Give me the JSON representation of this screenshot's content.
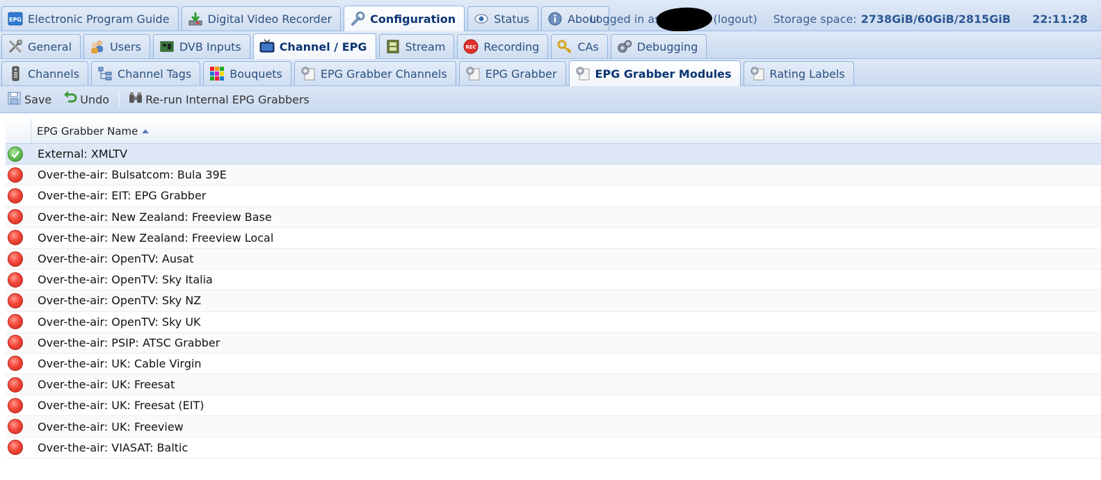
{
  "main_tabs": [
    {
      "label": "Electronic Program Guide",
      "icon": "epg-icon"
    },
    {
      "label": "Digital Video Recorder",
      "icon": "download-icon"
    },
    {
      "label": "Configuration",
      "icon": "wrench-icon",
      "active": true
    },
    {
      "label": "Status",
      "icon": "eye-icon"
    },
    {
      "label": "About",
      "icon": "info-icon"
    }
  ],
  "status": {
    "logged_in_prefix": "Logged in as",
    "logout": "(logout)",
    "storage_label": "Storage space:",
    "storage_value": "2738GiB/60GiB/2815GiB",
    "time": "22:11:28"
  },
  "config_tabs": [
    {
      "label": "General",
      "icon": "tools-icon"
    },
    {
      "label": "Users",
      "icon": "users-icon"
    },
    {
      "label": "DVB Inputs",
      "icon": "card-icon"
    },
    {
      "label": "Channel / EPG",
      "icon": "tv-icon",
      "active": true
    },
    {
      "label": "Stream",
      "icon": "film-icon"
    },
    {
      "label": "Recording",
      "icon": "rec-icon"
    },
    {
      "label": "CAs",
      "icon": "key-icon"
    },
    {
      "label": "Debugging",
      "icon": "gears-icon"
    }
  ],
  "epg_tabs": [
    {
      "label": "Channels",
      "icon": "remote-icon"
    },
    {
      "label": "Channel Tags",
      "icon": "tree-icon"
    },
    {
      "label": "Bouquets",
      "icon": "grid-icon"
    },
    {
      "label": "EPG Grabber Channels",
      "icon": "gear-doc-icon"
    },
    {
      "label": "EPG Grabber",
      "icon": "gear-doc-icon"
    },
    {
      "label": "EPG Grabber Modules",
      "icon": "gear-doc-icon",
      "active": true
    },
    {
      "label": "Rating Labels",
      "icon": "gear-doc-icon"
    }
  ],
  "toolbar": {
    "save": "Save",
    "undo": "Undo",
    "rerun": "Re-run Internal EPG Grabbers"
  },
  "grid": {
    "column_name": "EPG Grabber Name",
    "rows": [
      {
        "name": "External: XMLTV",
        "enabled": true
      },
      {
        "name": "Over-the-air: Bulsatcom: Bula 39E",
        "enabled": false
      },
      {
        "name": "Over-the-air: EIT: EPG Grabber",
        "enabled": false
      },
      {
        "name": "Over-the-air: New Zealand: Freeview Base",
        "enabled": false
      },
      {
        "name": "Over-the-air: New Zealand: Freeview Local",
        "enabled": false
      },
      {
        "name": "Over-the-air: OpenTV: Ausat",
        "enabled": false
      },
      {
        "name": "Over-the-air: OpenTV: Sky Italia",
        "enabled": false
      },
      {
        "name": "Over-the-air: OpenTV: Sky NZ",
        "enabled": false
      },
      {
        "name": "Over-the-air: OpenTV: Sky UK",
        "enabled": false
      },
      {
        "name": "Over-the-air: PSIP: ATSC Grabber",
        "enabled": false
      },
      {
        "name": "Over-the-air: UK: Cable Virgin",
        "enabled": false
      },
      {
        "name": "Over-the-air: UK: Freesat",
        "enabled": false
      },
      {
        "name": "Over-the-air: UK: Freesat (EIT)",
        "enabled": false
      },
      {
        "name": "Over-the-air: UK: Freeview",
        "enabled": false
      },
      {
        "name": "Over-the-air: VIASAT: Baltic",
        "enabled": false
      }
    ]
  }
}
